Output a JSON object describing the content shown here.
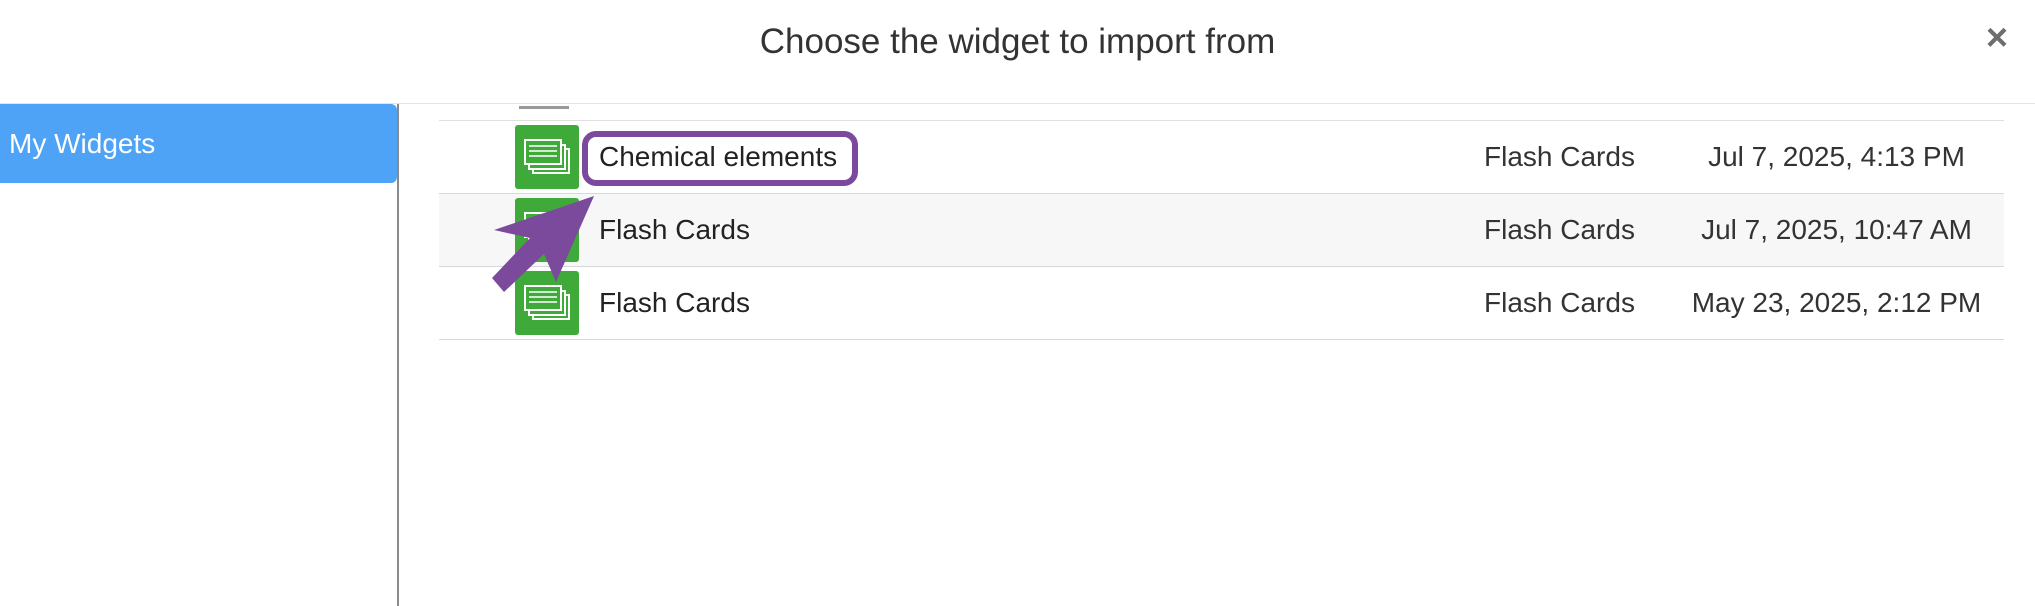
{
  "dialog": {
    "title": "Choose the widget to import from",
    "close_symbol": "×"
  },
  "sidebar": {
    "items": [
      {
        "label": "My Widgets",
        "selected": true
      }
    ]
  },
  "widgets": [
    {
      "name": "Chemical elements",
      "type": "Flash Cards",
      "date": "Jul 7, 2025, 4:13 PM",
      "icon": "flash-cards-icon"
    },
    {
      "name": "Flash Cards",
      "type": "Flash Cards",
      "date": "Jul 7, 2025, 10:47 AM",
      "icon": "flash-cards-icon"
    },
    {
      "name": "Flash Cards",
      "type": "Flash Cards",
      "date": "May 23, 2025, 2:12 PM",
      "icon": "flash-cards-icon"
    }
  ],
  "colors": {
    "sidebar_selected": "#4fa3f7",
    "widget_icon": "#3faa3a",
    "annotation": "#7b4a9c"
  }
}
